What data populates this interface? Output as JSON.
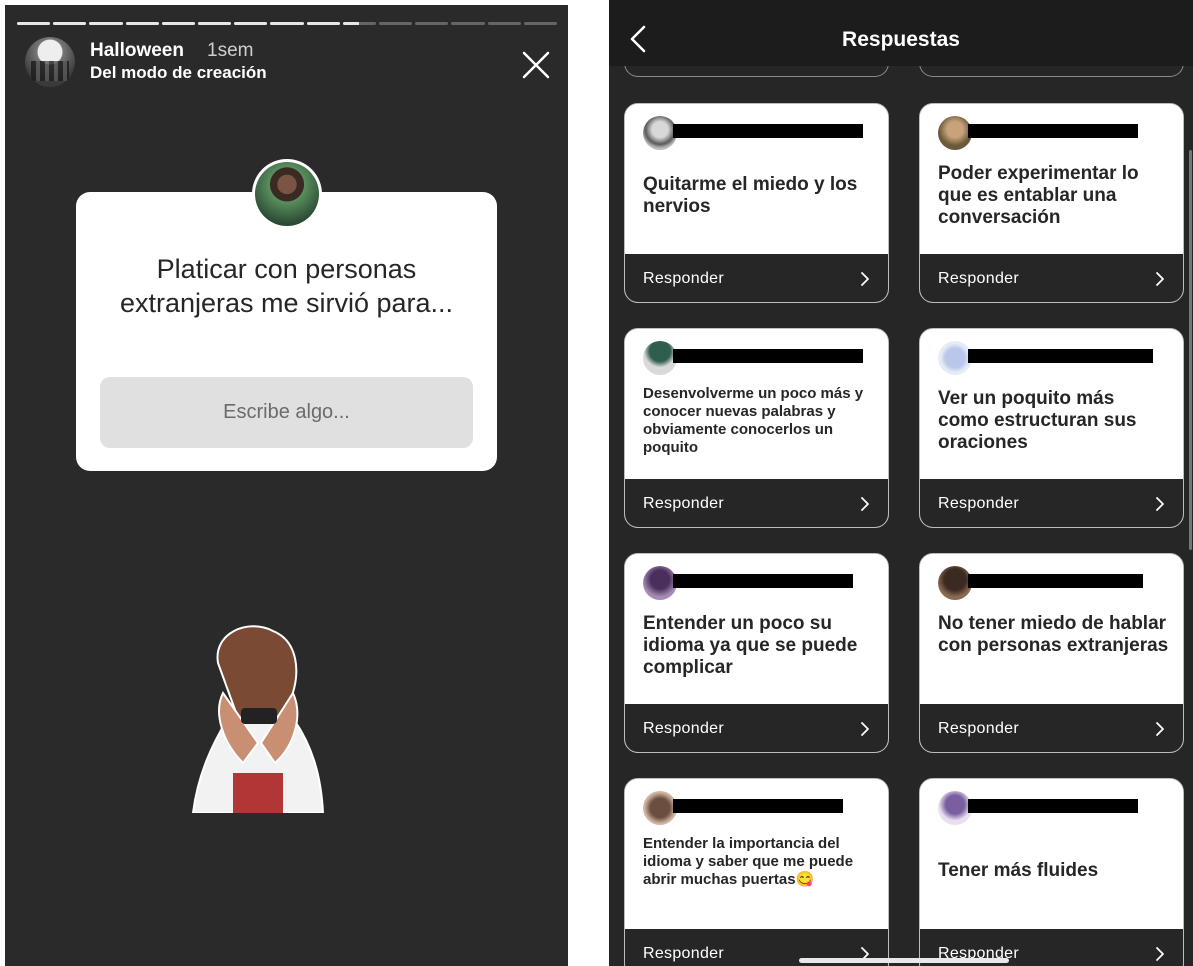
{
  "story": {
    "progress_segments": 15,
    "progress_filled": 9,
    "progress_partial": 0.5,
    "title": "Halloween",
    "time": "1sem",
    "subtitle": "Del modo de creación",
    "close_icon": "close-icon",
    "question": {
      "text": "Platicar con personas extranjeras me sirvió para...",
      "input_placeholder": "Escribe algo..."
    }
  },
  "responses": {
    "title": "Respuestas",
    "back_icon": "chevron-left-icon",
    "reply_label": "Responder",
    "cards": [
      {
        "answer": "Quitarme el miedo y los nervios",
        "size": "big"
      },
      {
        "answer": "Poder experimentar lo que es entablar una conversación",
        "size": "big"
      },
      {
        "answer": "Desenvolverme un poco más y conocer nuevas palabras y obviamente conocerlos un poquito",
        "size": "small"
      },
      {
        "answer": "Ver un poquito más como estructuran sus oraciones",
        "size": "big"
      },
      {
        "answer": "Entender un poco su idioma ya que se puede complicar",
        "size": "big"
      },
      {
        "answer": "No tener miedo de hablar con personas extranjeras",
        "size": "big"
      },
      {
        "answer": "Entender la importancia del idioma y saber que me puede abrir muchas puertas😋",
        "size": "small"
      },
      {
        "answer": "Tener más fluides",
        "size": "big"
      }
    ]
  },
  "colors": {
    "story_bg": "#2b2a2a",
    "panel_bg": "#262626",
    "card_bg": "#ffffff",
    "text_dark": "#262626"
  }
}
